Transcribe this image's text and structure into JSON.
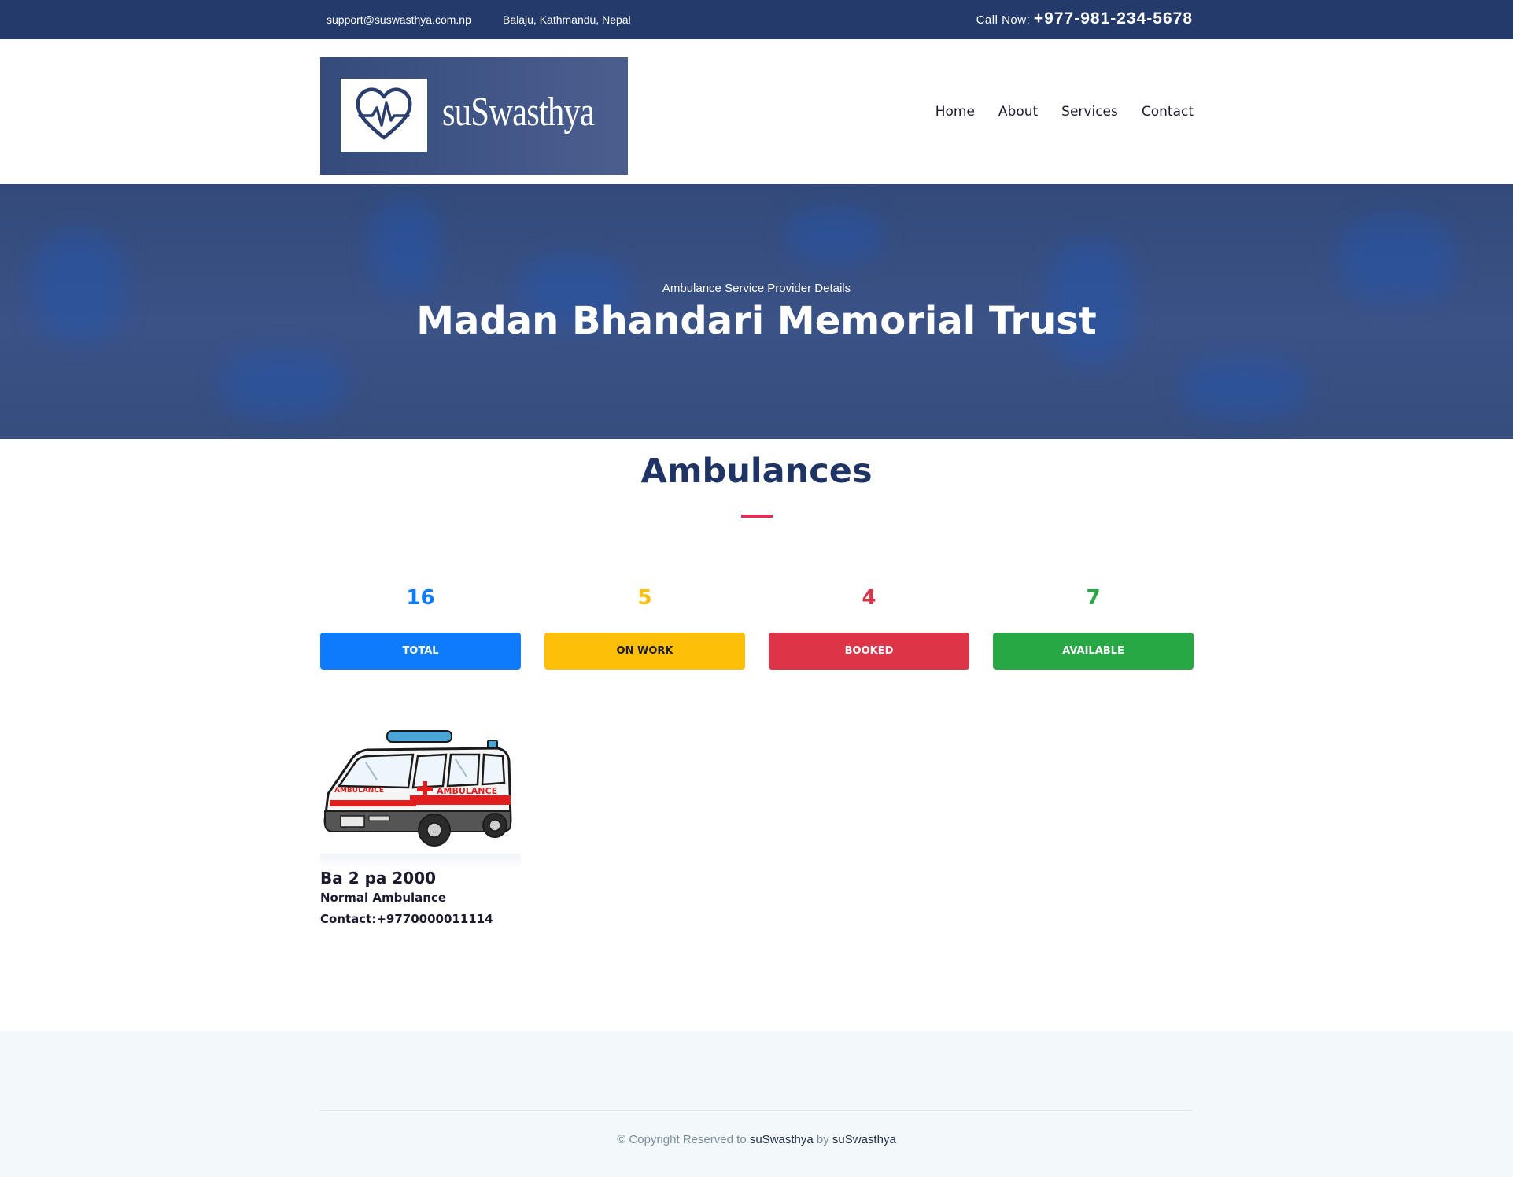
{
  "topbar": {
    "email": "support@suswasthya.com.np",
    "address": "Balaju, Kathmandu, Nepal",
    "call_label": "Call Now:",
    "phone": "+977-981-234-5678"
  },
  "logo": {
    "text": "suSwasthya",
    "icon": "heart-pulse-icon"
  },
  "nav": {
    "items": [
      "Home",
      "About",
      "Services",
      "Contact"
    ]
  },
  "hero": {
    "subtitle": "Ambulance Service Provider Details",
    "title": "Madan Bhandari Memorial Trust"
  },
  "section": {
    "title": "Ambulances"
  },
  "stats": [
    {
      "count": "16",
      "label": "TOTAL",
      "color": "#0d7bfc",
      "button_bg": "#0d7bfc",
      "button_text": "#ffffff"
    },
    {
      "count": "5",
      "label": "ON WORK",
      "color": "#fdbf08",
      "button_bg": "#fdbf08",
      "button_text": "#1b1b1b"
    },
    {
      "count": "4",
      "label": "BOOKED",
      "color": "#dd3547",
      "button_bg": "#dd3547",
      "button_text": "#ffffff"
    },
    {
      "count": "7",
      "label": "AVAILABLE",
      "color": "#28a745",
      "button_bg": "#28a745",
      "button_text": "#ffffff"
    }
  ],
  "ambulance": {
    "image_text_front": "AMBULANCE",
    "image_text_side": "AMBULANCE",
    "plate": "Ba 2 pa 2000",
    "type": "Normal Ambulance",
    "contact": "Contact:+9770000011114"
  },
  "footer": {
    "prefix": "© Copyright Reserved to",
    "brand1": "suSwasthya",
    "by": "by",
    "brand2": "suSwasthya"
  }
}
